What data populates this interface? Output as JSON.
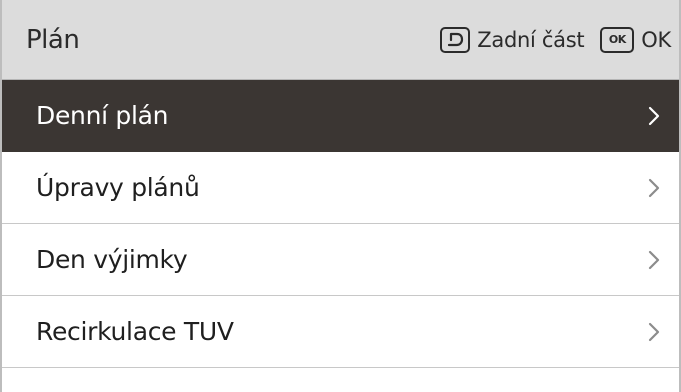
{
  "header": {
    "title": "Plán",
    "back": {
      "icon": "back-arrow-icon",
      "label": "Zadní část"
    },
    "ok": {
      "icon_text": "OK",
      "label": "OK"
    }
  },
  "menu": {
    "items": [
      {
        "label": "Denní plán",
        "selected": true,
        "icon": "chevron-right-icon"
      },
      {
        "label": "Úpravy plánů",
        "selected": false,
        "icon": "chevron-right-icon"
      },
      {
        "label": "Den výjimky",
        "selected": false,
        "icon": "chevron-right-icon"
      },
      {
        "label": "Recirkulace TUV",
        "selected": false,
        "icon": "chevron-right-icon"
      }
    ]
  },
  "colors": {
    "header_bg": "#dcdcdc",
    "selected_bg": "#3b3633",
    "text": "#1f1f1f",
    "chevron": "#8c8c8c"
  }
}
